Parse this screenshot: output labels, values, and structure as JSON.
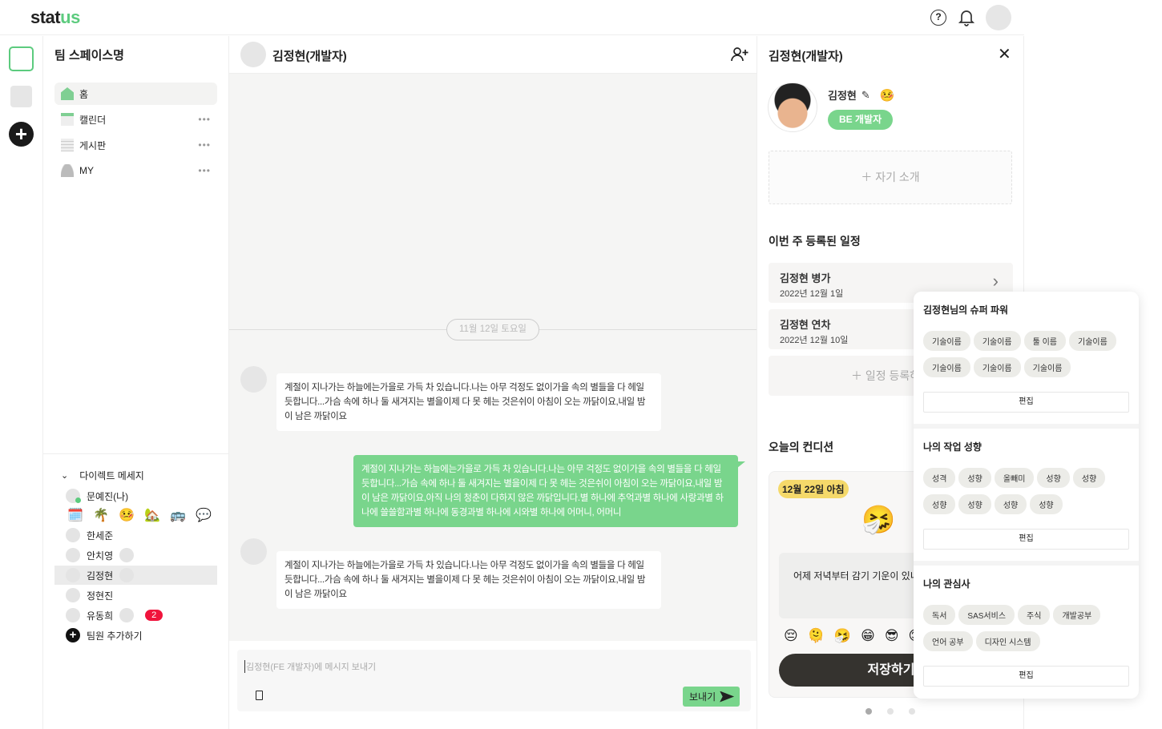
{
  "header": {
    "logo_main": "stat",
    "logo_accent": "us"
  },
  "sidebar": {
    "workspace_name": "팀 스페이스명",
    "nav": [
      {
        "label": "홈"
      },
      {
        "label": "캘린더"
      },
      {
        "label": "게시판"
      },
      {
        "label": "MY"
      }
    ],
    "dm_title": "다이렉트 메세지",
    "dms": [
      {
        "name": "문예진(나)"
      },
      {
        "name": "한세준"
      },
      {
        "name": "안치영"
      },
      {
        "name": "김정현"
      },
      {
        "name": "정현진"
      },
      {
        "name": "유동희",
        "badge": "2"
      }
    ],
    "status_emojis": [
      "🗓️",
      "🌴",
      "🤒",
      "🏡",
      "🚌",
      "💬"
    ],
    "add_member": "팀원 추가하기"
  },
  "chat": {
    "title": "김정현(개발자)",
    "date_divider": "11월 12일 토요일",
    "messages": [
      {
        "dir": "in",
        "text": "계절이 지나가는 하늘에는가을로 가득 차 있습니다.나는 아무 걱정도 없이가을 속의 별들을 다 헤일 듯합니다...가슴 속에 하나 둘 새겨지는 별을이제 다 못 헤는 것은쉬이 아침이 오는 까닭이요,내일 밤이 남은 까닭이요"
      },
      {
        "dir": "out",
        "text": "계절이 지나가는 하늘에는가을로 가득 차 있습니다.나는 아무 걱정도 없이가을 속의 별들을 다 헤일 듯합니다...가슴 속에 하나 둘 새겨지는 별을이제 다 못 헤는 것은쉬이 아침이 오는 까닭이요,내일 밤이 남은 까닭이요,아직 나의 청춘이 다하지 않은 까닭입니다.별 하나에 추억과별 하나에 사랑과별 하나에 쓸쓸함과별 하나에 동경과별 하나에 시와별 하나에 어머니, 어머니"
      },
      {
        "dir": "in",
        "text": "계절이 지나가는 하늘에는가을로 가득 차 있습니다.나는 아무 걱정도 없이가을 속의 별들을 다 헤일 듯합니다...가슴 속에 하나 둘 새겨지는 별을이제 다 못 헤는 것은쉬이 아침이 오는 까닭이요,내일 밤이 남은 까닭이요"
      }
    ],
    "input_placeholder": "김정현(FE 개발자)에 메시지 보내기",
    "send_label": "보내기"
  },
  "profile": {
    "title": "김정현(개발자)",
    "name": "김정현",
    "status_emoji": "🤒",
    "role": "BE 개발자",
    "intro_add": "자기 소개",
    "schedule_title": "이번 주 등록된 일정",
    "schedules": [
      {
        "title": "김정현 병가",
        "date": "2022년 12월 1일"
      },
      {
        "title": "김정현 연차",
        "date": "2022년 12월 10일"
      }
    ],
    "add_schedule": "일정 등록하기",
    "condition_title": "오늘의 컨디션",
    "condition_date": "12월 22일 아침",
    "condition_emoji": "🤧",
    "condition_text": "어제 저녁부터 감기 기운이 있네요",
    "condition_options": [
      "😔",
      "🫠",
      "🤧",
      "😁",
      "😎",
      "😊"
    ],
    "save_label": "저장하기",
    "pages": 3,
    "current_page": 1
  },
  "popover": {
    "sections": [
      {
        "title": "김정현님의 슈퍼 파워",
        "chips": [
          "기술이름",
          "기술이름",
          "툴 이름",
          "기술이름",
          "기술이름",
          "기술이름",
          "기술이름"
        ],
        "edit": "편집"
      },
      {
        "title": "나의 작업 성향",
        "chips": [
          "성격",
          "성향",
          "올빼미",
          "성향",
          "성향",
          "성향",
          "성향",
          "성향",
          "성향"
        ],
        "edit": "편집"
      },
      {
        "title": "나의 관심사",
        "chips": [
          "독서",
          "SAS서비스",
          "주식",
          "개발공부",
          "언어 공부",
          "디자인 시스템"
        ],
        "edit": "편집"
      }
    ]
  }
}
